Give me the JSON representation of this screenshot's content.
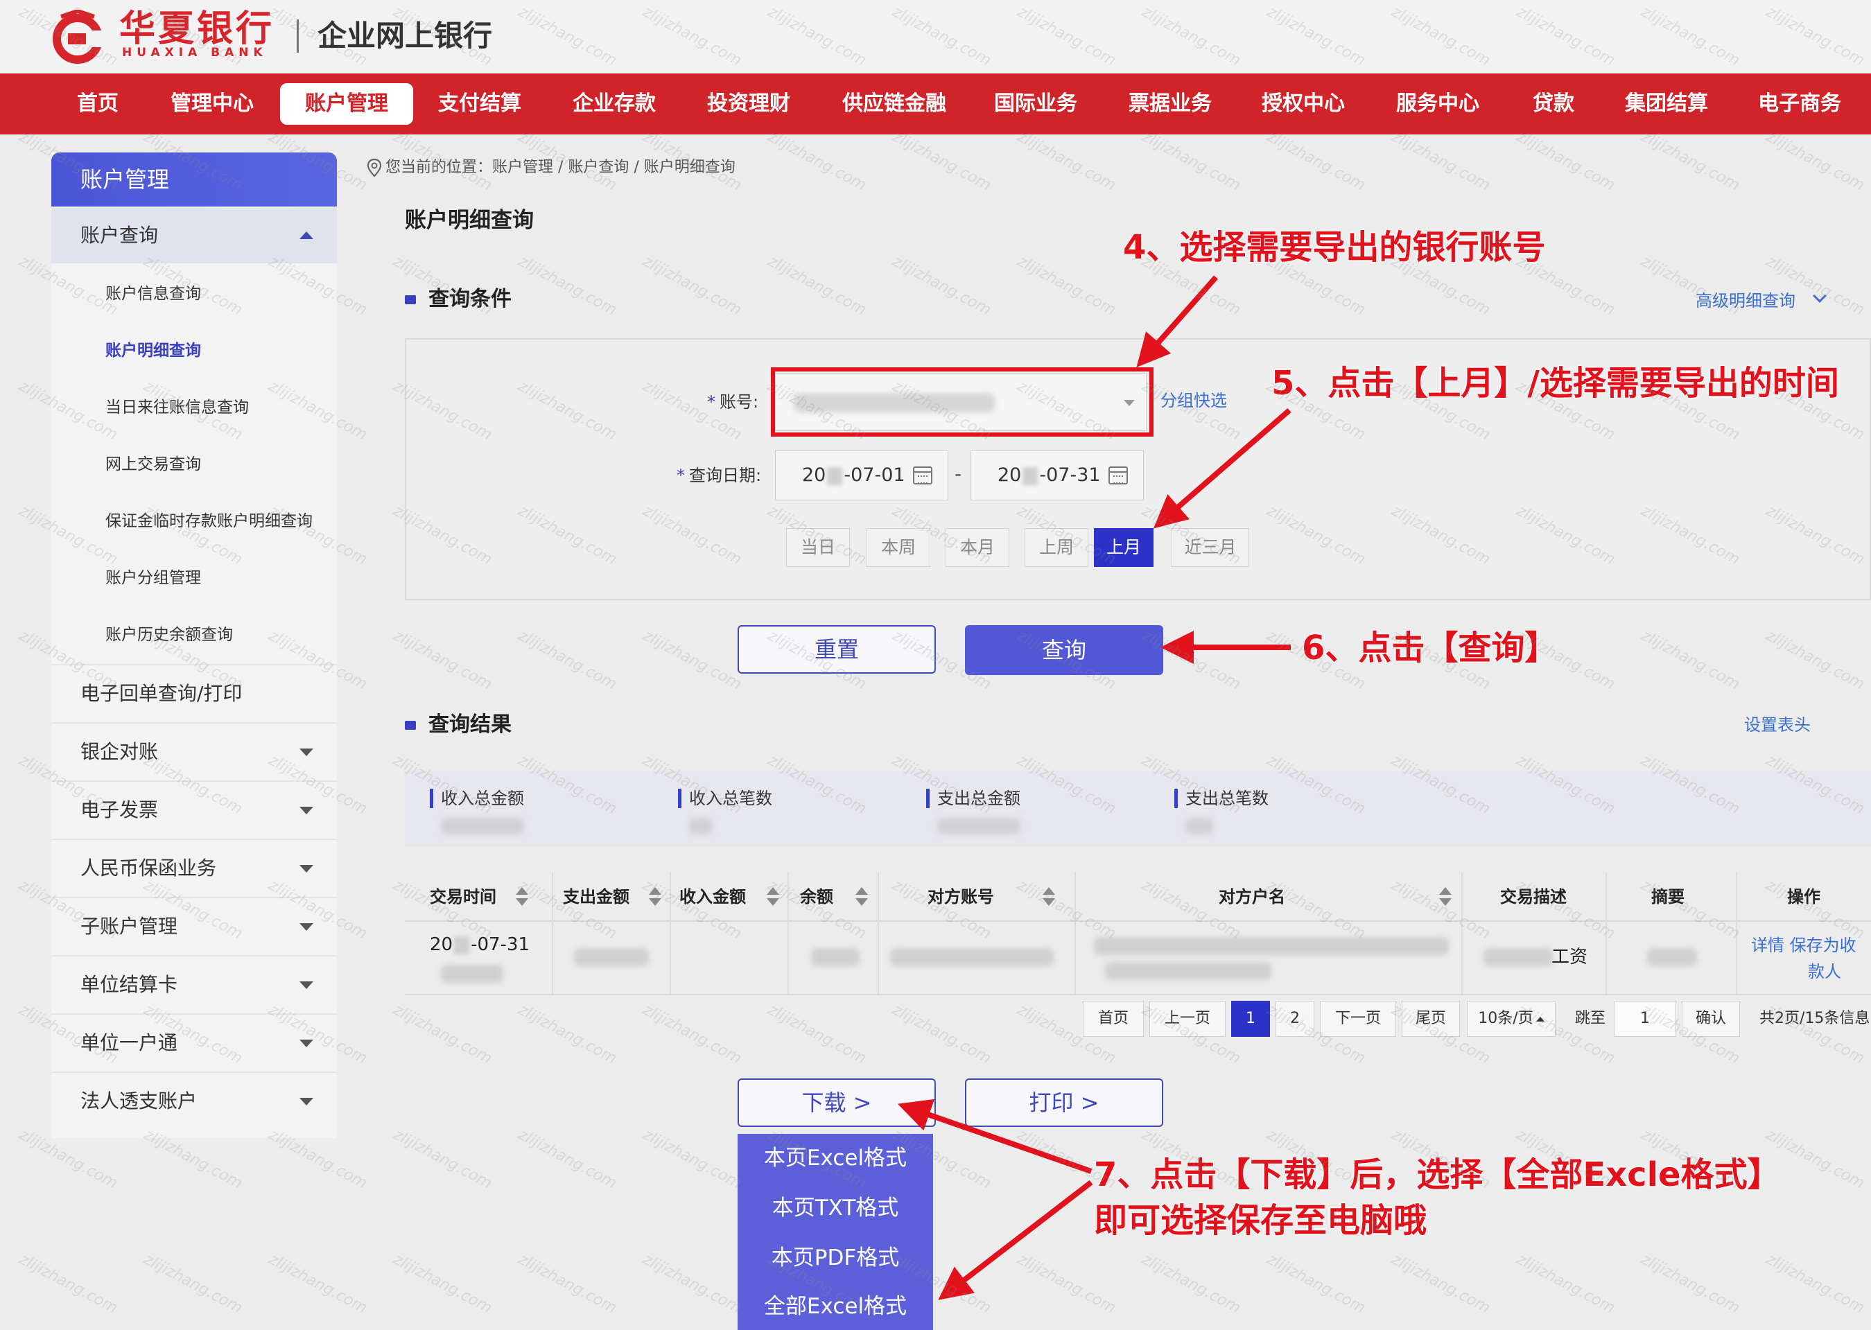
{
  "brand": {
    "name_cn": "华夏银行",
    "name_en": "HUAXIA BANK",
    "app_title": "企业网上银行",
    "accent_color": "#d1242a",
    "primary_color": "#3a3fc0"
  },
  "nav": {
    "items": [
      {
        "label": "首页"
      },
      {
        "label": "管理中心"
      },
      {
        "label": "账户管理",
        "active": true
      },
      {
        "label": "支付结算"
      },
      {
        "label": "企业存款"
      },
      {
        "label": "投资理财"
      },
      {
        "label": "供应链金融"
      },
      {
        "label": "国际业务"
      },
      {
        "label": "票据业务"
      },
      {
        "label": "授权中心"
      },
      {
        "label": "服务中心"
      },
      {
        "label": "贷款"
      },
      {
        "label": "集团结算"
      },
      {
        "label": "电子商务"
      }
    ]
  },
  "sidebar": {
    "title": "账户管理",
    "group": "账户查询",
    "sub_items": [
      {
        "label": "账户信息查询"
      },
      {
        "label": "账户明细查询",
        "active": true
      },
      {
        "label": "当日来往账信息查询"
      },
      {
        "label": "网上交易查询"
      },
      {
        "label": "保证金临时存款账户明细查询"
      },
      {
        "label": "账户分组管理"
      },
      {
        "label": "账户历史余额查询"
      }
    ],
    "menus": [
      {
        "label": "电子回单查询/打印"
      },
      {
        "label": "银企对账"
      },
      {
        "label": "电子发票"
      },
      {
        "label": "人民币保函业务"
      },
      {
        "label": "子账户管理"
      },
      {
        "label": "单位结算卡"
      },
      {
        "label": "单位一户通"
      },
      {
        "label": "法人透支账户"
      }
    ]
  },
  "breadcrumb": "您当前的位置：账户管理 / 账户查询 / 账户明细查询",
  "page_title": "账户明细查询",
  "query": {
    "section_title": "查询条件",
    "advanced_link": "高级明细查询",
    "account_label": "账号:",
    "group_quick": "分组快选",
    "date_label": "查询日期:",
    "date_from": {
      "prefix": "20",
      "suffix": "-07-01"
    },
    "date_to": {
      "prefix": "20",
      "suffix": "-07-31"
    },
    "quick_buttons": [
      "当日",
      "本周",
      "本月",
      "上周",
      "上月",
      "近三月"
    ],
    "active_quick": "上月",
    "reset_label": "重置",
    "search_label": "查询"
  },
  "results": {
    "section_title": "查询结果",
    "settings_link": "设置表头",
    "summary": [
      "收入总金额",
      "收入总笔数",
      "支出总金额",
      "支出总笔数"
    ],
    "columns": [
      "交易时间",
      "支出金额",
      "收入金额",
      "余额",
      "对方账号",
      "对方户名",
      "交易描述",
      "摘要",
      "操作"
    ],
    "row": {
      "time": "-07-31",
      "time_prefix": "20",
      "desc_suffix": "工资",
      "op_line1": "详情 保存为收",
      "op_line2": "款人"
    }
  },
  "pagination": {
    "first": "首页",
    "prev": "上一页",
    "pages": [
      "1",
      "2"
    ],
    "next": "下一页",
    "last": "尾页",
    "page_size": "10条/页",
    "jump_label": "跳至",
    "jump_value": "1",
    "confirm": "确认",
    "total": "共2页/15条信息"
  },
  "actions": {
    "download": "下载 >",
    "print": "打印 >",
    "download_menu": [
      "本页Excel格式",
      "本页TXT格式",
      "本页PDF格式",
      "全部Excel格式"
    ]
  },
  "annotations": {
    "step4": "4、选择需要导出的银行账号",
    "step5": "5、点击【上月】/选择需要导出的时间",
    "step6": "6、点击【查询】",
    "step7_line1": "7、点击【下载】后，选择【全部Excle格式】",
    "step7_line2": "即可选择保存至电脑哦"
  },
  "watermark": "zlijizhang.com"
}
